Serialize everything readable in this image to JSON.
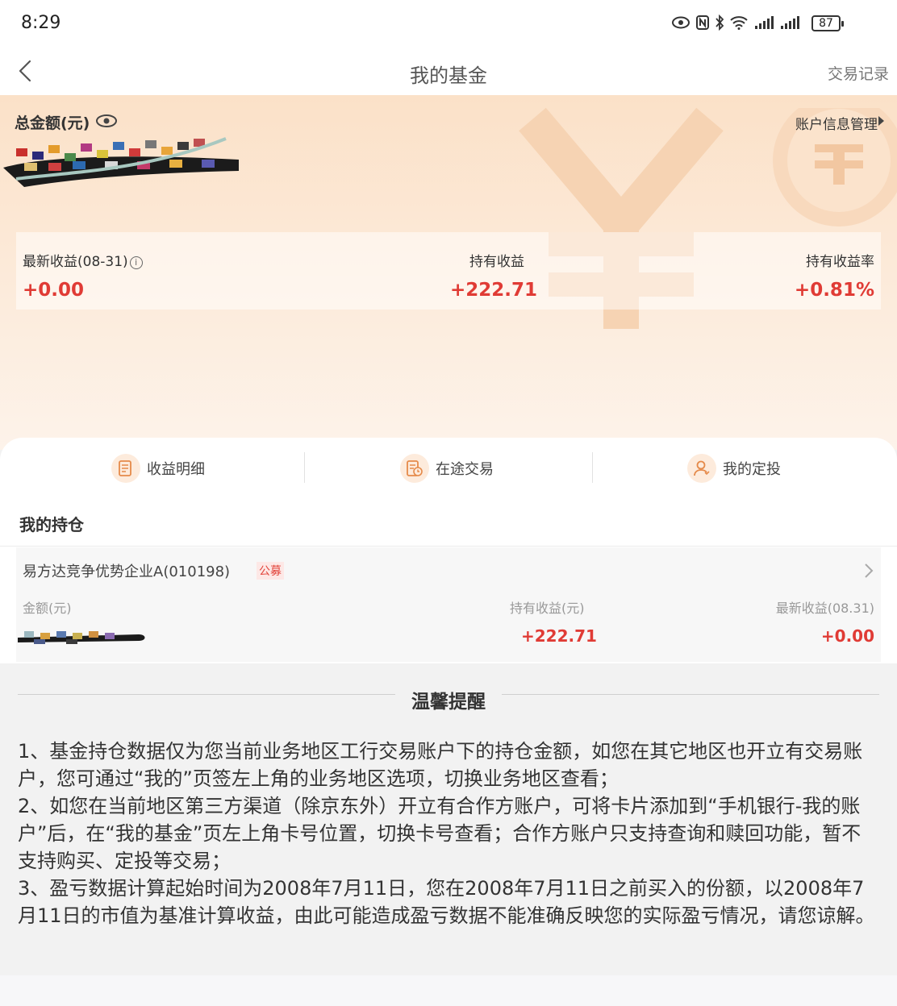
{
  "status_bar": {
    "time": "8:29",
    "battery": "87",
    "icons": [
      "eye-icon",
      "nfc-icon",
      "bluetooth-icon",
      "wifi-icon",
      "signal-icon",
      "signal-icon"
    ]
  },
  "nav": {
    "title": "我的基金",
    "right_link": "交易记录"
  },
  "summary": {
    "total_label": "总金额(元)",
    "account_mgmt": "账户信息管理",
    "stats": [
      {
        "label": "最新收益(08-31)",
        "value": "+0.00"
      },
      {
        "label": "持有收益",
        "value": "+222.71"
      },
      {
        "label": "持有收益率",
        "value": "+0.81%"
      }
    ]
  },
  "quick_actions": [
    {
      "label": "收益明细",
      "icon": "document-icon"
    },
    {
      "label": "在途交易",
      "icon": "document-clock-icon"
    },
    {
      "label": "我的定投",
      "icon": "user-icon"
    }
  ],
  "holdings": {
    "title": "我的持仓",
    "items": [
      {
        "name": "易方达竞争优势企业A(010198)",
        "tag": "公募",
        "amount_label": "金额(元)",
        "profit_label": "持有收益(元)",
        "profit_value": "+222.71",
        "latest_label": "最新收益(08.31)",
        "latest_value": "+0.00"
      }
    ]
  },
  "reminder": {
    "title": "温馨提醒",
    "items": [
      "1、基金持仓数据仅为您当前业务地区工行交易账户下的持仓金额，如您在其它地区也开立有交易账户，您可通过“我的”页签左上角的业务地区选项，切换业务地区查看；",
      "2、如您在当前地区第三方渠道（除京东外）开立有合作方账户，可将卡片添加到“手机银行-我的账户”后，在“我的基金”页左上角卡号位置，切换卡号查看；合作方账户只支持查询和赎回功能，暂不支持购买、定投等交易；",
      "3、盈亏数据计算起始时间为2008年7月11日，您在2008年7月11日之前买入的份额，以2008年7月11日的市值为基准计算收益，由此可能造成盈亏数据不能准确反映您的实际盈亏情况，请您谅解。"
    ]
  }
}
